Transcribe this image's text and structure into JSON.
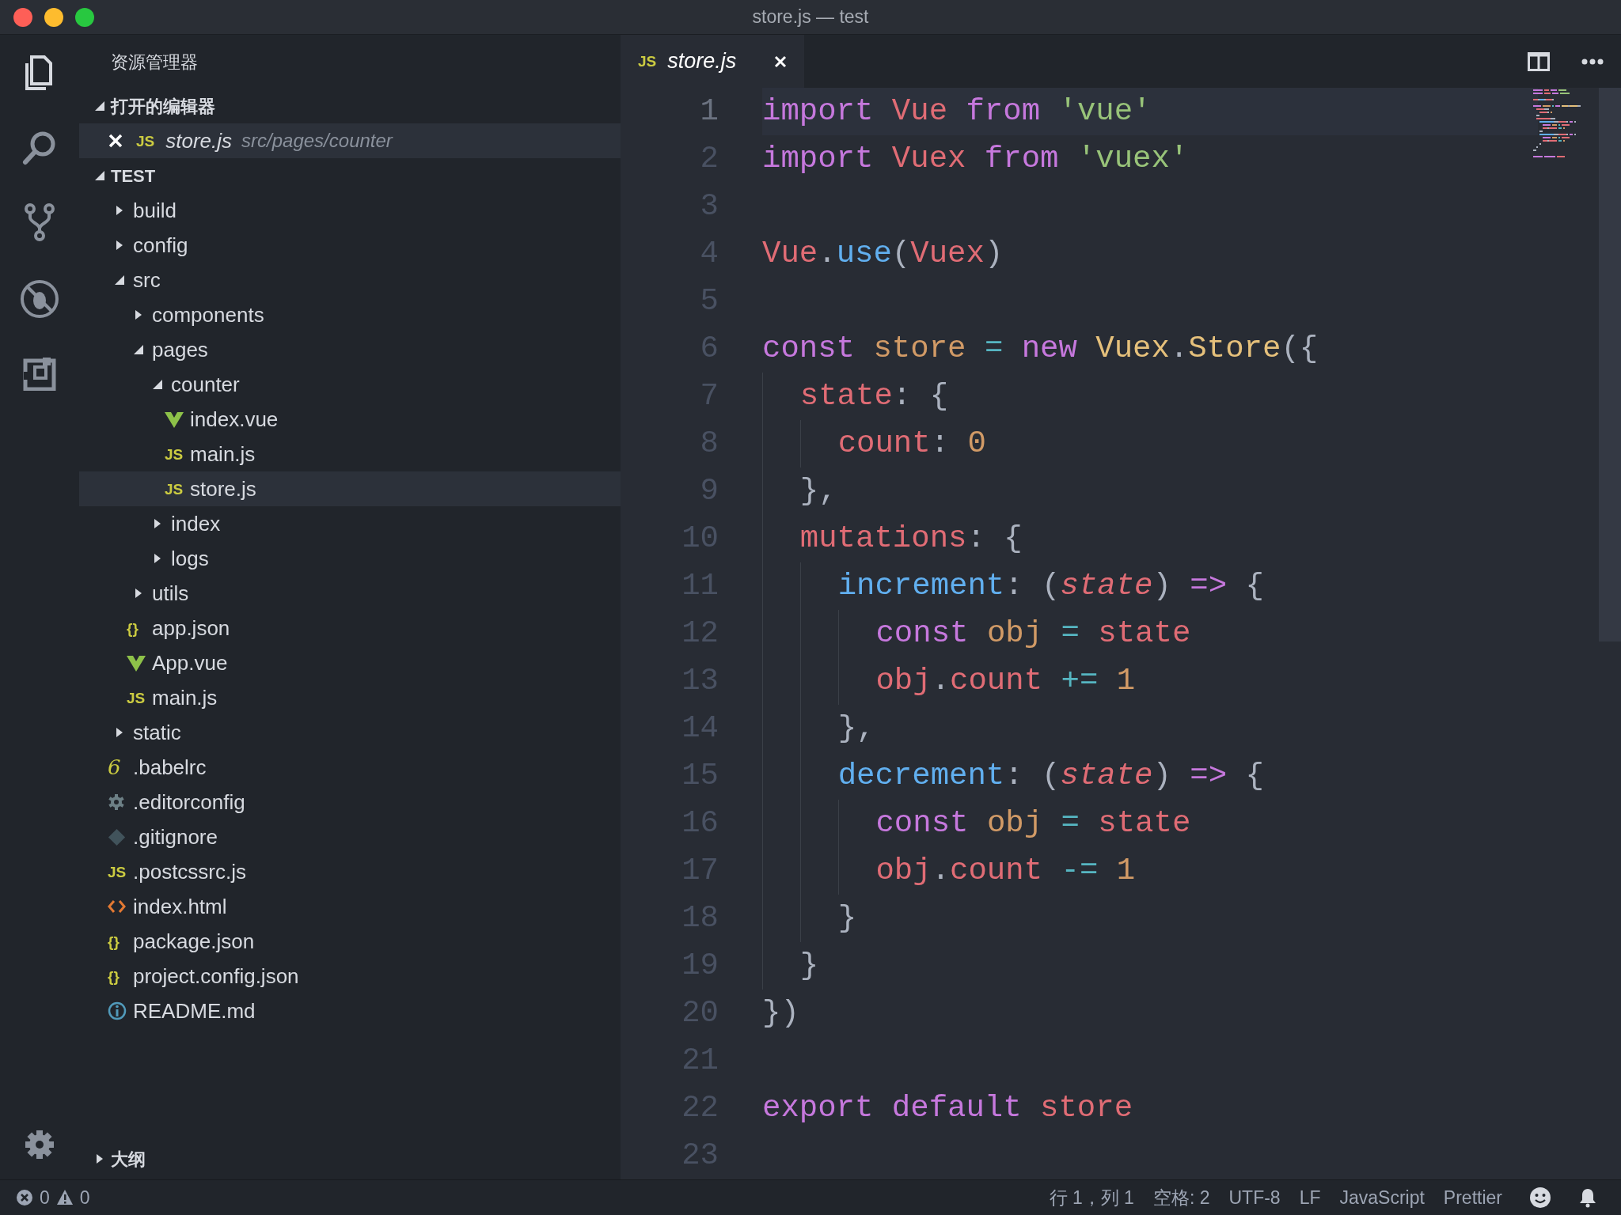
{
  "window": {
    "title": "store.js — test"
  },
  "activity_bar": [
    {
      "selected": true
    },
    {
      "selected": false
    },
    {
      "selected": false
    },
    {
      "selected": false
    },
    {
      "selected": false
    }
  ],
  "sidebar": {
    "title": "资源管理器",
    "open_editors": {
      "title": "打开的编辑器",
      "expanded": true,
      "items": [
        {
          "name": "store.js",
          "path": "src/pages/counter",
          "kind": "js",
          "badge": "JS"
        }
      ]
    },
    "project": {
      "title": "TEST",
      "expanded": true,
      "tree": [
        {
          "name": "build",
          "kind": "folder",
          "expanded": false,
          "selected": false
        },
        {
          "name": "config",
          "kind": "folder",
          "expanded": false,
          "selected": false
        },
        {
          "name": "src",
          "kind": "folder",
          "expanded": true,
          "selected": false,
          "children": [
            {
              "name": "components",
              "kind": "folder",
              "expanded": false,
              "selected": false
            },
            {
              "name": "pages",
              "kind": "folder",
              "expanded": true,
              "selected": false,
              "children": [
                {
                  "name": "counter",
                  "kind": "folder",
                  "expanded": true,
                  "selected": false,
                  "children": [
                    {
                      "name": "index.vue",
                      "kind": "vue",
                      "selected": false
                    },
                    {
                      "name": "main.js",
                      "kind": "js",
                      "badge": "JS",
                      "selected": false
                    },
                    {
                      "name": "store.js",
                      "kind": "js",
                      "badge": "JS",
                      "selected": true
                    }
                  ]
                },
                {
                  "name": "index",
                  "kind": "folder",
                  "expanded": false,
                  "selected": false
                },
                {
                  "name": "logs",
                  "kind": "folder",
                  "expanded": false,
                  "selected": false
                }
              ]
            },
            {
              "name": "utils",
              "kind": "folder",
              "expanded": false,
              "selected": false
            },
            {
              "name": "app.json",
              "kind": "json",
              "badge": "{}",
              "selected": false
            },
            {
              "name": "App.vue",
              "kind": "vue",
              "selected": false
            },
            {
              "name": "main.js",
              "kind": "js",
              "badge": "JS",
              "selected": false
            }
          ]
        },
        {
          "name": "static",
          "kind": "folder",
          "expanded": false,
          "selected": false
        },
        {
          "name": ".babelrc",
          "kind": "babel",
          "badge": "6",
          "selected": false
        },
        {
          "name": ".editorconfig",
          "kind": "config",
          "selected": false
        },
        {
          "name": ".gitignore",
          "kind": "git",
          "selected": false
        },
        {
          "name": ".postcssrc.js",
          "kind": "js",
          "badge": "JS",
          "selected": false
        },
        {
          "name": "index.html",
          "kind": "html",
          "selected": false
        },
        {
          "name": "package.json",
          "kind": "json",
          "badge": "{}",
          "selected": false
        },
        {
          "name": "project.config.json",
          "kind": "json",
          "badge": "{}",
          "selected": false
        },
        {
          "name": "README.md",
          "kind": "info",
          "selected": false
        }
      ]
    },
    "outline": {
      "title": "大纲",
      "expanded": false
    }
  },
  "tabs": [
    {
      "name": "store.js",
      "kind": "js",
      "badge": "JS",
      "selected": true
    }
  ],
  "code": [
    {
      "number": "1",
      "current": true,
      "tokens": [
        {
          "text": "import ",
          "color": "#c678dd"
        },
        {
          "text": "Vue ",
          "color": "#e06c75"
        },
        {
          "text": "from ",
          "color": "#c678dd"
        },
        {
          "text": "'vue'",
          "color": "#98c379"
        }
      ]
    },
    {
      "number": "2",
      "current": false,
      "tokens": [
        {
          "text": "import ",
          "color": "#c678dd"
        },
        {
          "text": "Vuex ",
          "color": "#e06c75"
        },
        {
          "text": "from ",
          "color": "#c678dd"
        },
        {
          "text": "'vuex'",
          "color": "#98c379"
        }
      ]
    },
    {
      "number": "3",
      "current": false
    },
    {
      "number": "4",
      "current": false,
      "tokens": [
        {
          "text": "Vue",
          "color": "#e06c75"
        },
        {
          "text": ".",
          "color": "#abb2bf"
        },
        {
          "text": "use",
          "color": "#61afef"
        },
        {
          "text": "(",
          "color": "#abb2bf"
        },
        {
          "text": "Vuex",
          "color": "#e06c75"
        },
        {
          "text": ")",
          "color": "#abb2bf"
        }
      ]
    },
    {
      "number": "5",
      "current": false
    },
    {
      "number": "6",
      "current": false,
      "tokens": [
        {
          "text": "const ",
          "color": "#c678dd"
        },
        {
          "text": "store ",
          "color": "#d19a66"
        },
        {
          "text": "= ",
          "color": "#56b6c2"
        },
        {
          "text": "new ",
          "color": "#c678dd"
        },
        {
          "text": "Vuex",
          "color": "#e5c07b"
        },
        {
          "text": ".",
          "color": "#abb2bf"
        },
        {
          "text": "Store",
          "color": "#e5c07b"
        },
        {
          "text": "({",
          "color": "#abb2bf"
        }
      ]
    },
    {
      "number": "7",
      "current": false,
      "tokens": [
        {
          "text": "  state",
          "color": "#e06c75"
        },
        {
          "text": ": {",
          "color": "#abb2bf"
        }
      ]
    },
    {
      "number": "8",
      "current": false,
      "tokens": [
        {
          "text": "    count",
          "color": "#e06c75"
        },
        {
          "text": ": ",
          "color": "#abb2bf"
        },
        {
          "text": "0",
          "color": "#d19a66"
        }
      ]
    },
    {
      "number": "9",
      "current": false,
      "tokens": [
        {
          "text": "  },",
          "color": "#abb2bf"
        }
      ]
    },
    {
      "number": "10",
      "current": false,
      "tokens": [
        {
          "text": "  mutations",
          "color": "#e06c75"
        },
        {
          "text": ": {",
          "color": "#abb2bf"
        }
      ]
    },
    {
      "number": "11",
      "current": false,
      "tokens": [
        {
          "text": "    increment",
          "color": "#61afef"
        },
        {
          "text": ": (",
          "color": "#abb2bf"
        },
        {
          "text": "state",
          "color": "#e06c75",
          "italic": true
        },
        {
          "text": ") ",
          "color": "#abb2bf"
        },
        {
          "text": "=>",
          "color": "#c678dd"
        },
        {
          "text": " {",
          "color": "#abb2bf"
        }
      ]
    },
    {
      "number": "12",
      "current": false,
      "tokens": [
        {
          "text": "      const ",
          "color": "#c678dd"
        },
        {
          "text": "obj ",
          "color": "#d19a66"
        },
        {
          "text": "= ",
          "color": "#56b6c2"
        },
        {
          "text": "state",
          "color": "#e06c75"
        }
      ]
    },
    {
      "number": "13",
      "current": false,
      "tokens": [
        {
          "text": "      obj",
          "color": "#e06c75"
        },
        {
          "text": ".",
          "color": "#abb2bf"
        },
        {
          "text": "count ",
          "color": "#e06c75"
        },
        {
          "text": "+= ",
          "color": "#56b6c2"
        },
        {
          "text": "1",
          "color": "#d19a66"
        }
      ]
    },
    {
      "number": "14",
      "current": false,
      "tokens": [
        {
          "text": "    },",
          "color": "#abb2bf"
        }
      ]
    },
    {
      "number": "15",
      "current": false,
      "tokens": [
        {
          "text": "    decrement",
          "color": "#61afef"
        },
        {
          "text": ": (",
          "color": "#abb2bf"
        },
        {
          "text": "state",
          "color": "#e06c75",
          "italic": true
        },
        {
          "text": ") ",
          "color": "#abb2bf"
        },
        {
          "text": "=>",
          "color": "#c678dd"
        },
        {
          "text": " {",
          "color": "#abb2bf"
        }
      ]
    },
    {
      "number": "16",
      "current": false,
      "tokens": [
        {
          "text": "      const ",
          "color": "#c678dd"
        },
        {
          "text": "obj ",
          "color": "#d19a66"
        },
        {
          "text": "= ",
          "color": "#56b6c2"
        },
        {
          "text": "state",
          "color": "#e06c75"
        }
      ]
    },
    {
      "number": "17",
      "current": false,
      "tokens": [
        {
          "text": "      obj",
          "color": "#e06c75"
        },
        {
          "text": ".",
          "color": "#abb2bf"
        },
        {
          "text": "count ",
          "color": "#e06c75"
        },
        {
          "text": "-= ",
          "color": "#56b6c2"
        },
        {
          "text": "1",
          "color": "#d19a66"
        }
      ]
    },
    {
      "number": "18",
      "current": false,
      "tokens": [
        {
          "text": "    }",
          "color": "#abb2bf"
        }
      ]
    },
    {
      "number": "19",
      "current": false,
      "tokens": [
        {
          "text": "  }",
          "color": "#abb2bf"
        }
      ]
    },
    {
      "number": "20",
      "current": false,
      "tokens": [
        {
          "text": "})",
          "color": "#abb2bf"
        }
      ]
    },
    {
      "number": "21",
      "current": false
    },
    {
      "number": "22",
      "current": false,
      "tokens": [
        {
          "text": "export ",
          "color": "#c678dd"
        },
        {
          "text": "default ",
          "color": "#c678dd"
        },
        {
          "text": "store",
          "color": "#e06c75"
        }
      ]
    },
    {
      "number": "23",
      "current": false
    }
  ],
  "status_bar": {
    "errors": "0",
    "warnings": "0",
    "items": [
      "行 1，列 1",
      "空格: 2",
      "UTF-8",
      "LF",
      "JavaScript",
      "Prettier"
    ]
  }
}
